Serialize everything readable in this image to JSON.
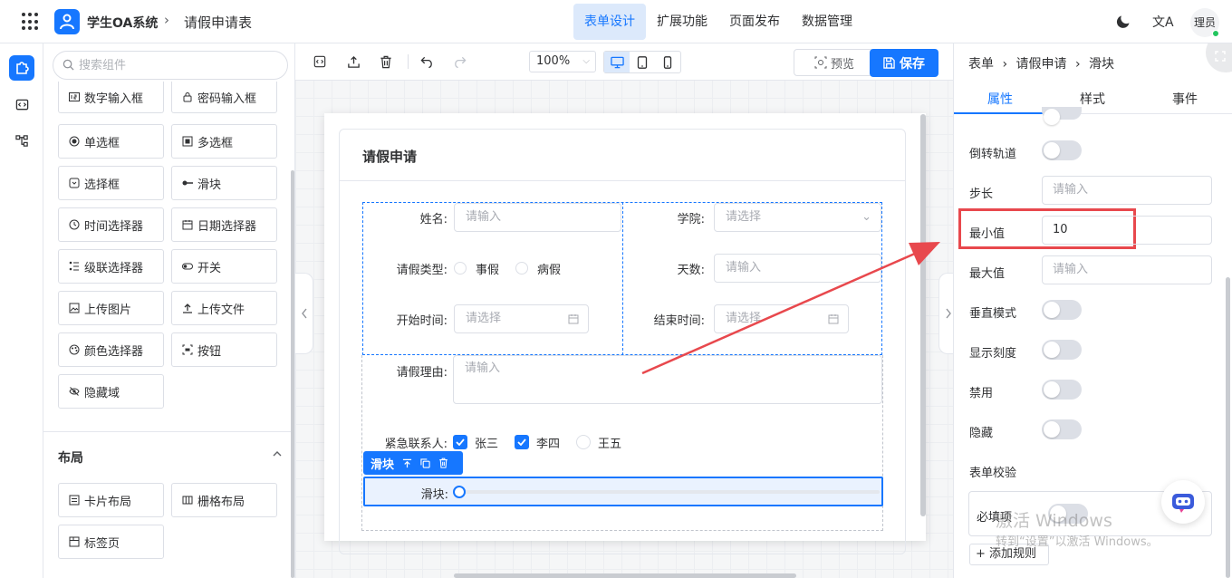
{
  "header": {
    "app_name": "学生OA系统",
    "crumb_sep": "›",
    "page_name": "请假申请表",
    "nav": [
      "表单设计",
      "扩展功能",
      "页面发布",
      "数据管理"
    ],
    "translate_glyph": "文A",
    "user": "理员"
  },
  "sidebar": {
    "search_placeholder": "搜索组件",
    "components": [
      "数字输入框",
      "密码输入框",
      "单选框",
      "多选框",
      "选择框",
      "滑块",
      "时间选择器",
      "日期选择器",
      "级联选择器",
      "开关",
      "上传图片",
      "上传文件",
      "颜色选择器",
      "按钮",
      "隐藏域"
    ],
    "layout_title": "布局",
    "layouts": [
      "卡片布局",
      "栅格布局",
      "标签页"
    ]
  },
  "toolbar": {
    "zoom": "100%",
    "preview": "预览",
    "save": "保存"
  },
  "form": {
    "card_title": "请假申请",
    "name_label": "姓名:",
    "name_placeholder": "请输入",
    "college_label": "学院:",
    "college_placeholder": "请选择",
    "leave_type_label": "请假类型:",
    "leave_types": [
      "事假",
      "病假"
    ],
    "days_label": "天数:",
    "days_placeholder": "请输入",
    "start_label": "开始时间:",
    "start_placeholder": "请选择",
    "end_label": "结束时间:",
    "end_placeholder": "请选择",
    "reason_label": "请假理由:",
    "reason_placeholder": "请输入",
    "contact_label": "紧急联系人:",
    "contacts": [
      {
        "name": "张三",
        "checked": true
      },
      {
        "name": "李四",
        "checked": true
      },
      {
        "name": "王五",
        "checked": false
      }
    ],
    "selected_tag": "滑块",
    "slider_label": "滑块:",
    "slider_value": 0
  },
  "props": {
    "crumbs": [
      "表单",
      "请假申请",
      "滑块"
    ],
    "crumb_sep": "›",
    "tabs": [
      "属性",
      "样式",
      "事件"
    ],
    "rows": {
      "reverse": "倒转轨道",
      "step": "步长",
      "step_placeholder": "请输入",
      "min": "最小值",
      "min_value": "10",
      "max": "最大值",
      "max_placeholder": "请输入",
      "vertical": "垂直模式",
      "show_ticks": "显示刻度",
      "disabled": "禁用",
      "hidden": "隐藏",
      "validation": "表单校验",
      "required": "必填项",
      "add_rule": "+ 添加规则"
    }
  },
  "watermark": {
    "line1": "激活 Windows",
    "line2": "转到“设置”以激活 Windows。"
  },
  "colors": {
    "accent": "#1677ff",
    "highlight": "#e8484d"
  }
}
